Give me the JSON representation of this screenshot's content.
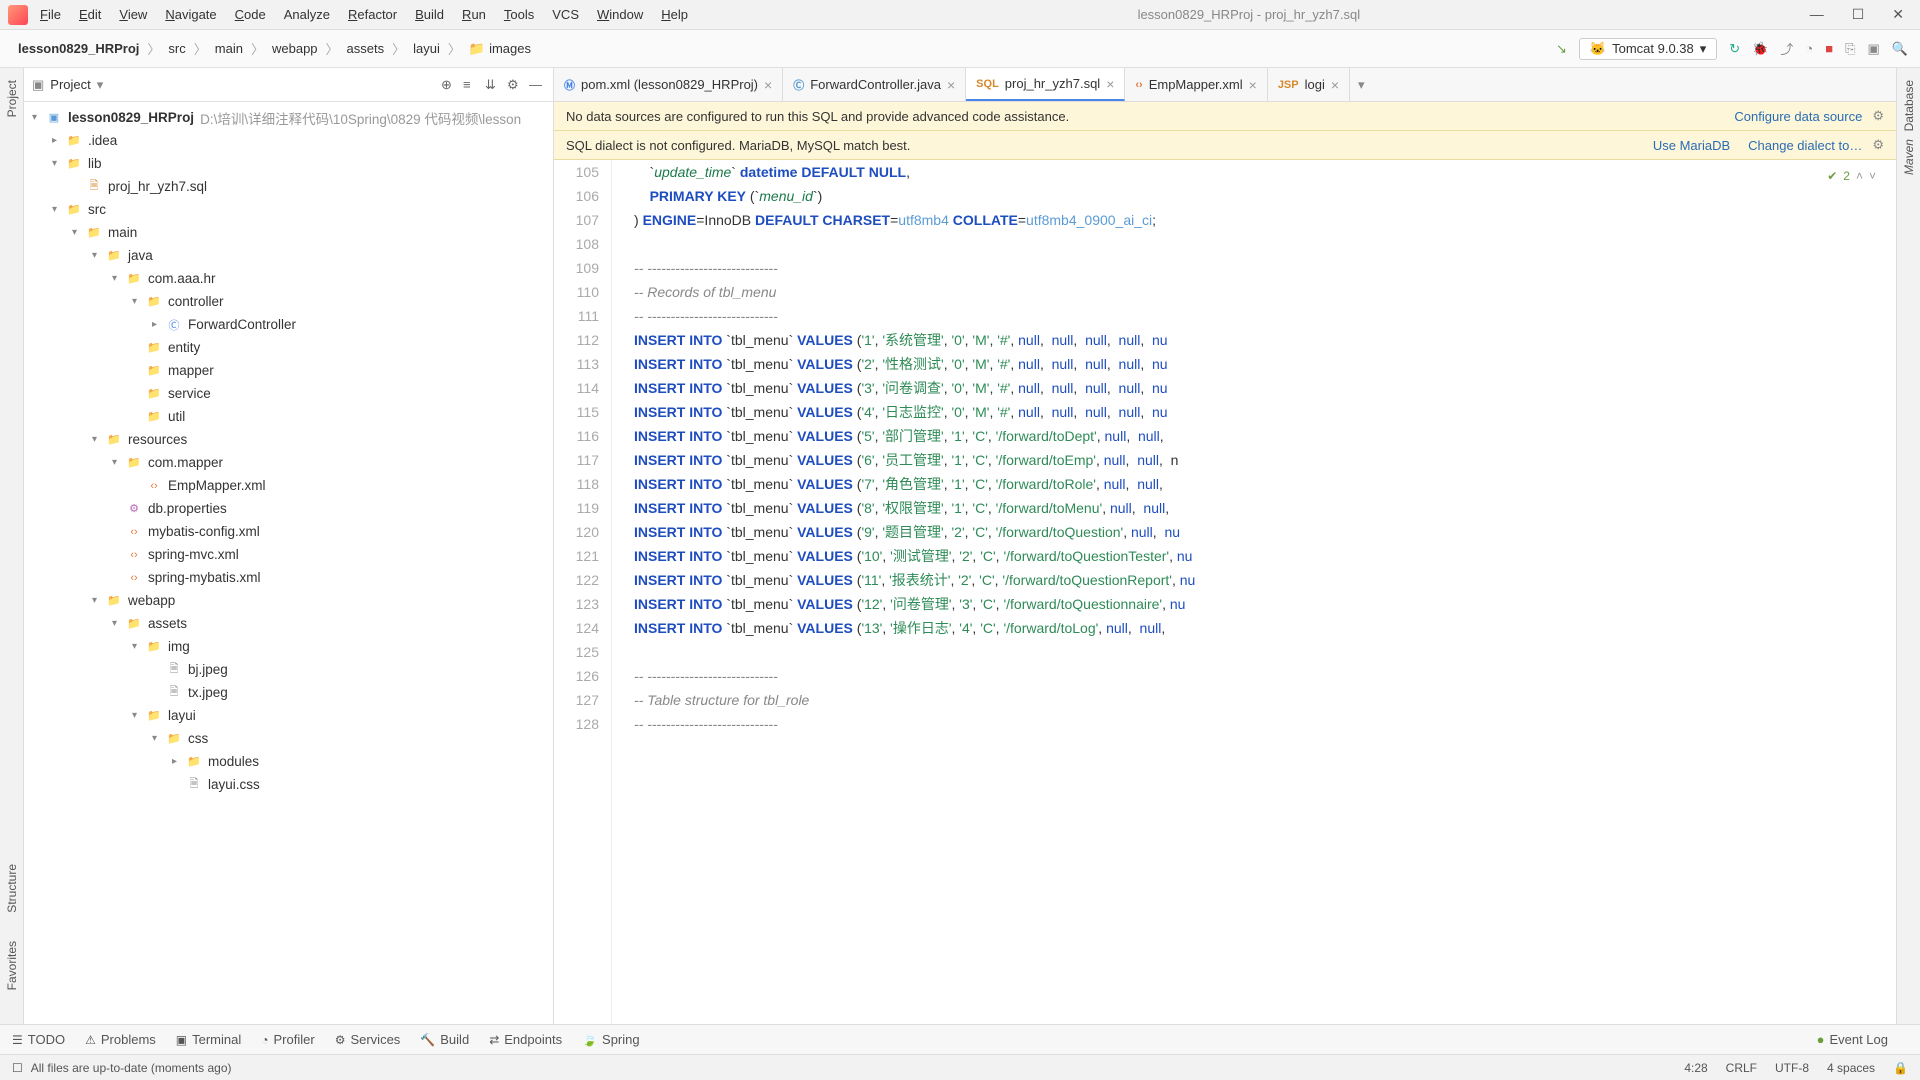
{
  "window_title": "lesson0829_HRProj - proj_hr_yzh7.sql",
  "menu": [
    "File",
    "Edit",
    "View",
    "Navigate",
    "Code",
    "Analyze",
    "Refactor",
    "Build",
    "Run",
    "Tools",
    "VCS",
    "Window",
    "Help"
  ],
  "menu_underline": [
    "F",
    "E",
    "V",
    "N",
    "C",
    "",
    "R",
    "B",
    "R",
    "T",
    "",
    "W",
    "H"
  ],
  "breadcrumb": [
    "lesson0829_HRProj",
    "src",
    "main",
    "webapp",
    "assets",
    "layui",
    "images"
  ],
  "run_config": "Tomcat 9.0.38",
  "project_panel_title": "Project",
  "tree": [
    {
      "d": 0,
      "exp": "▾",
      "icon": "module",
      "label": "lesson0829_HRProj",
      "path": "D:\\培训\\详细注释代码\\10Spring\\0829 代码视频\\lesson"
    },
    {
      "d": 1,
      "exp": "▸",
      "icon": "folder",
      "label": ".idea"
    },
    {
      "d": 1,
      "exp": "▾",
      "icon": "folder",
      "label": "lib"
    },
    {
      "d": 2,
      "exp": "",
      "icon": "sql",
      "label": "proj_hr_yzh7.sql"
    },
    {
      "d": 1,
      "exp": "▾",
      "icon": "folder",
      "label": "src"
    },
    {
      "d": 2,
      "exp": "▾",
      "icon": "folder",
      "label": "main"
    },
    {
      "d": 3,
      "exp": "▾",
      "icon": "folder-b",
      "label": "java"
    },
    {
      "d": 4,
      "exp": "▾",
      "icon": "folder",
      "label": "com.aaa.hr"
    },
    {
      "d": 5,
      "exp": "▾",
      "icon": "folder",
      "label": "controller"
    },
    {
      "d": 6,
      "exp": "▸",
      "icon": "java",
      "label": "ForwardController"
    },
    {
      "d": 5,
      "exp": "",
      "icon": "folder",
      "label": "entity"
    },
    {
      "d": 5,
      "exp": "",
      "icon": "folder",
      "label": "mapper"
    },
    {
      "d": 5,
      "exp": "",
      "icon": "folder",
      "label": "service"
    },
    {
      "d": 5,
      "exp": "",
      "icon": "folder",
      "label": "util"
    },
    {
      "d": 3,
      "exp": "▾",
      "icon": "folder-r",
      "label": "resources"
    },
    {
      "d": 4,
      "exp": "▾",
      "icon": "folder",
      "label": "com.mapper"
    },
    {
      "d": 5,
      "exp": "",
      "icon": "xml",
      "label": "EmpMapper.xml"
    },
    {
      "d": 4,
      "exp": "",
      "icon": "prop",
      "label": "db.properties"
    },
    {
      "d": 4,
      "exp": "",
      "icon": "xml",
      "label": "mybatis-config.xml"
    },
    {
      "d": 4,
      "exp": "",
      "icon": "xml",
      "label": "spring-mvc.xml"
    },
    {
      "d": 4,
      "exp": "",
      "icon": "xml",
      "label": "spring-mybatis.xml"
    },
    {
      "d": 3,
      "exp": "▾",
      "icon": "folder-w",
      "label": "webapp"
    },
    {
      "d": 4,
      "exp": "▾",
      "icon": "folder",
      "label": "assets"
    },
    {
      "d": 5,
      "exp": "▾",
      "icon": "folder",
      "label": "img"
    },
    {
      "d": 6,
      "exp": "",
      "icon": "file",
      "label": "bj.jpeg"
    },
    {
      "d": 6,
      "exp": "",
      "icon": "file",
      "label": "tx.jpeg"
    },
    {
      "d": 5,
      "exp": "▾",
      "icon": "folder",
      "label": "layui"
    },
    {
      "d": 6,
      "exp": "▾",
      "icon": "folder",
      "label": "css"
    },
    {
      "d": 7,
      "exp": "▸",
      "icon": "folder",
      "label": "modules"
    },
    {
      "d": 7,
      "exp": "",
      "icon": "file",
      "label": "layui.css"
    }
  ],
  "tabs": [
    {
      "icon": "m",
      "label": "pom.xml (lesson0829_HRProj)",
      "active": false
    },
    {
      "icon": "java",
      "label": "ForwardController.java",
      "active": false
    },
    {
      "icon": "sql",
      "label": "proj_hr_yzh7.sql",
      "active": true
    },
    {
      "icon": "xml",
      "label": "EmpMapper.xml",
      "active": false
    },
    {
      "icon": "jsp",
      "label": "logi",
      "active": false
    }
  ],
  "notif1": {
    "text": "No data sources are configured to run this SQL and provide advanced code assistance.",
    "link": "Configure data source"
  },
  "notif2": {
    "text": "SQL dialect is not configured. MariaDB, MySQL match best.",
    "link1": "Use MariaDB",
    "link2": "Change dialect to…"
  },
  "inspection_count": "2",
  "code_start_line": 105,
  "code_lines": [
    {
      "t": "code",
      "raw": "    `update_time` datetime DEFAULT NULL,"
    },
    {
      "t": "code",
      "raw": "    PRIMARY KEY (`menu_id`)"
    },
    {
      "t": "code",
      "raw": ") ENGINE=InnoDB DEFAULT CHARSET=utf8mb4 COLLATE=utf8mb4_0900_ai_ci;"
    },
    {
      "t": "blank",
      "raw": ""
    },
    {
      "t": "cmt",
      "raw": "-- ----------------------------"
    },
    {
      "t": "cmt",
      "raw": "-- Records of tbl_menu"
    },
    {
      "t": "cmt",
      "raw": "-- ----------------------------"
    },
    {
      "t": "ins",
      "id": "1",
      "name": "系统管理",
      "p": "0",
      "ty": "M",
      "url": "#",
      "tail": "null, null, null, null, nu"
    },
    {
      "t": "ins",
      "id": "2",
      "name": "性格测试",
      "p": "0",
      "ty": "M",
      "url": "#",
      "tail": "null, null, null, null, nu"
    },
    {
      "t": "ins",
      "id": "3",
      "name": "问卷调查",
      "p": "0",
      "ty": "M",
      "url": "#",
      "tail": "null, null, null, null, nu"
    },
    {
      "t": "ins",
      "id": "4",
      "name": "日志监控",
      "p": "0",
      "ty": "M",
      "url": "#",
      "tail": "null, null, null, null, nu"
    },
    {
      "t": "ins",
      "id": "5",
      "name": "部门管理",
      "p": "1",
      "ty": "C",
      "url": "/forward/toDept",
      "tail": "null, null, "
    },
    {
      "t": "ins",
      "id": "6",
      "name": "员工管理",
      "p": "1",
      "ty": "C",
      "url": "/forward/toEmp",
      "tail": "null, null, n"
    },
    {
      "t": "ins",
      "id": "7",
      "name": "角色管理",
      "p": "1",
      "ty": "C",
      "url": "/forward/toRole",
      "tail": "null, null, "
    },
    {
      "t": "ins",
      "id": "8",
      "name": "权限管理",
      "p": "1",
      "ty": "C",
      "url": "/forward/toMenu",
      "tail": "null, null, "
    },
    {
      "t": "ins",
      "id": "9",
      "name": "题目管理",
      "p": "2",
      "ty": "C",
      "url": "/forward/toQuestion",
      "tail": "null, nu"
    },
    {
      "t": "ins",
      "id": "10",
      "name": "测试管理",
      "p": "2",
      "ty": "C",
      "url": "/forward/toQuestionTester",
      "tail": "nu"
    },
    {
      "t": "ins",
      "id": "11",
      "name": "报表统计",
      "p": "2",
      "ty": "C",
      "url": "/forward/toQuestionReport",
      "tail": "nu"
    },
    {
      "t": "ins",
      "id": "12",
      "name": "问卷管理",
      "p": "3",
      "ty": "C",
      "url": "/forward/toQuestionnaire",
      "tail": "nu"
    },
    {
      "t": "ins",
      "id": "13",
      "name": "操作日志",
      "p": "4",
      "ty": "C",
      "url": "/forward/toLog",
      "tail": "null, null, "
    },
    {
      "t": "blank",
      "raw": ""
    },
    {
      "t": "cmt",
      "raw": "-- ----------------------------"
    },
    {
      "t": "cmt",
      "raw": "-- Table structure for tbl_role"
    },
    {
      "t": "cmt",
      "raw": "-- ----------------------------"
    }
  ],
  "bottom_tabs": [
    "TODO",
    "Problems",
    "Terminal",
    "Profiler",
    "Services",
    "Build",
    "Endpoints",
    "Spring"
  ],
  "event_log": "Event Log",
  "status_msg": "All files are up-to-date (moments ago)",
  "status_pos": "4:28",
  "status_le": "CRLF",
  "status_enc": "UTF-8",
  "status_indent": "4 spaces",
  "left_rail": [
    "Project",
    "Structure",
    "Favorites"
  ],
  "right_rail": [
    "Database",
    "Maven"
  ]
}
